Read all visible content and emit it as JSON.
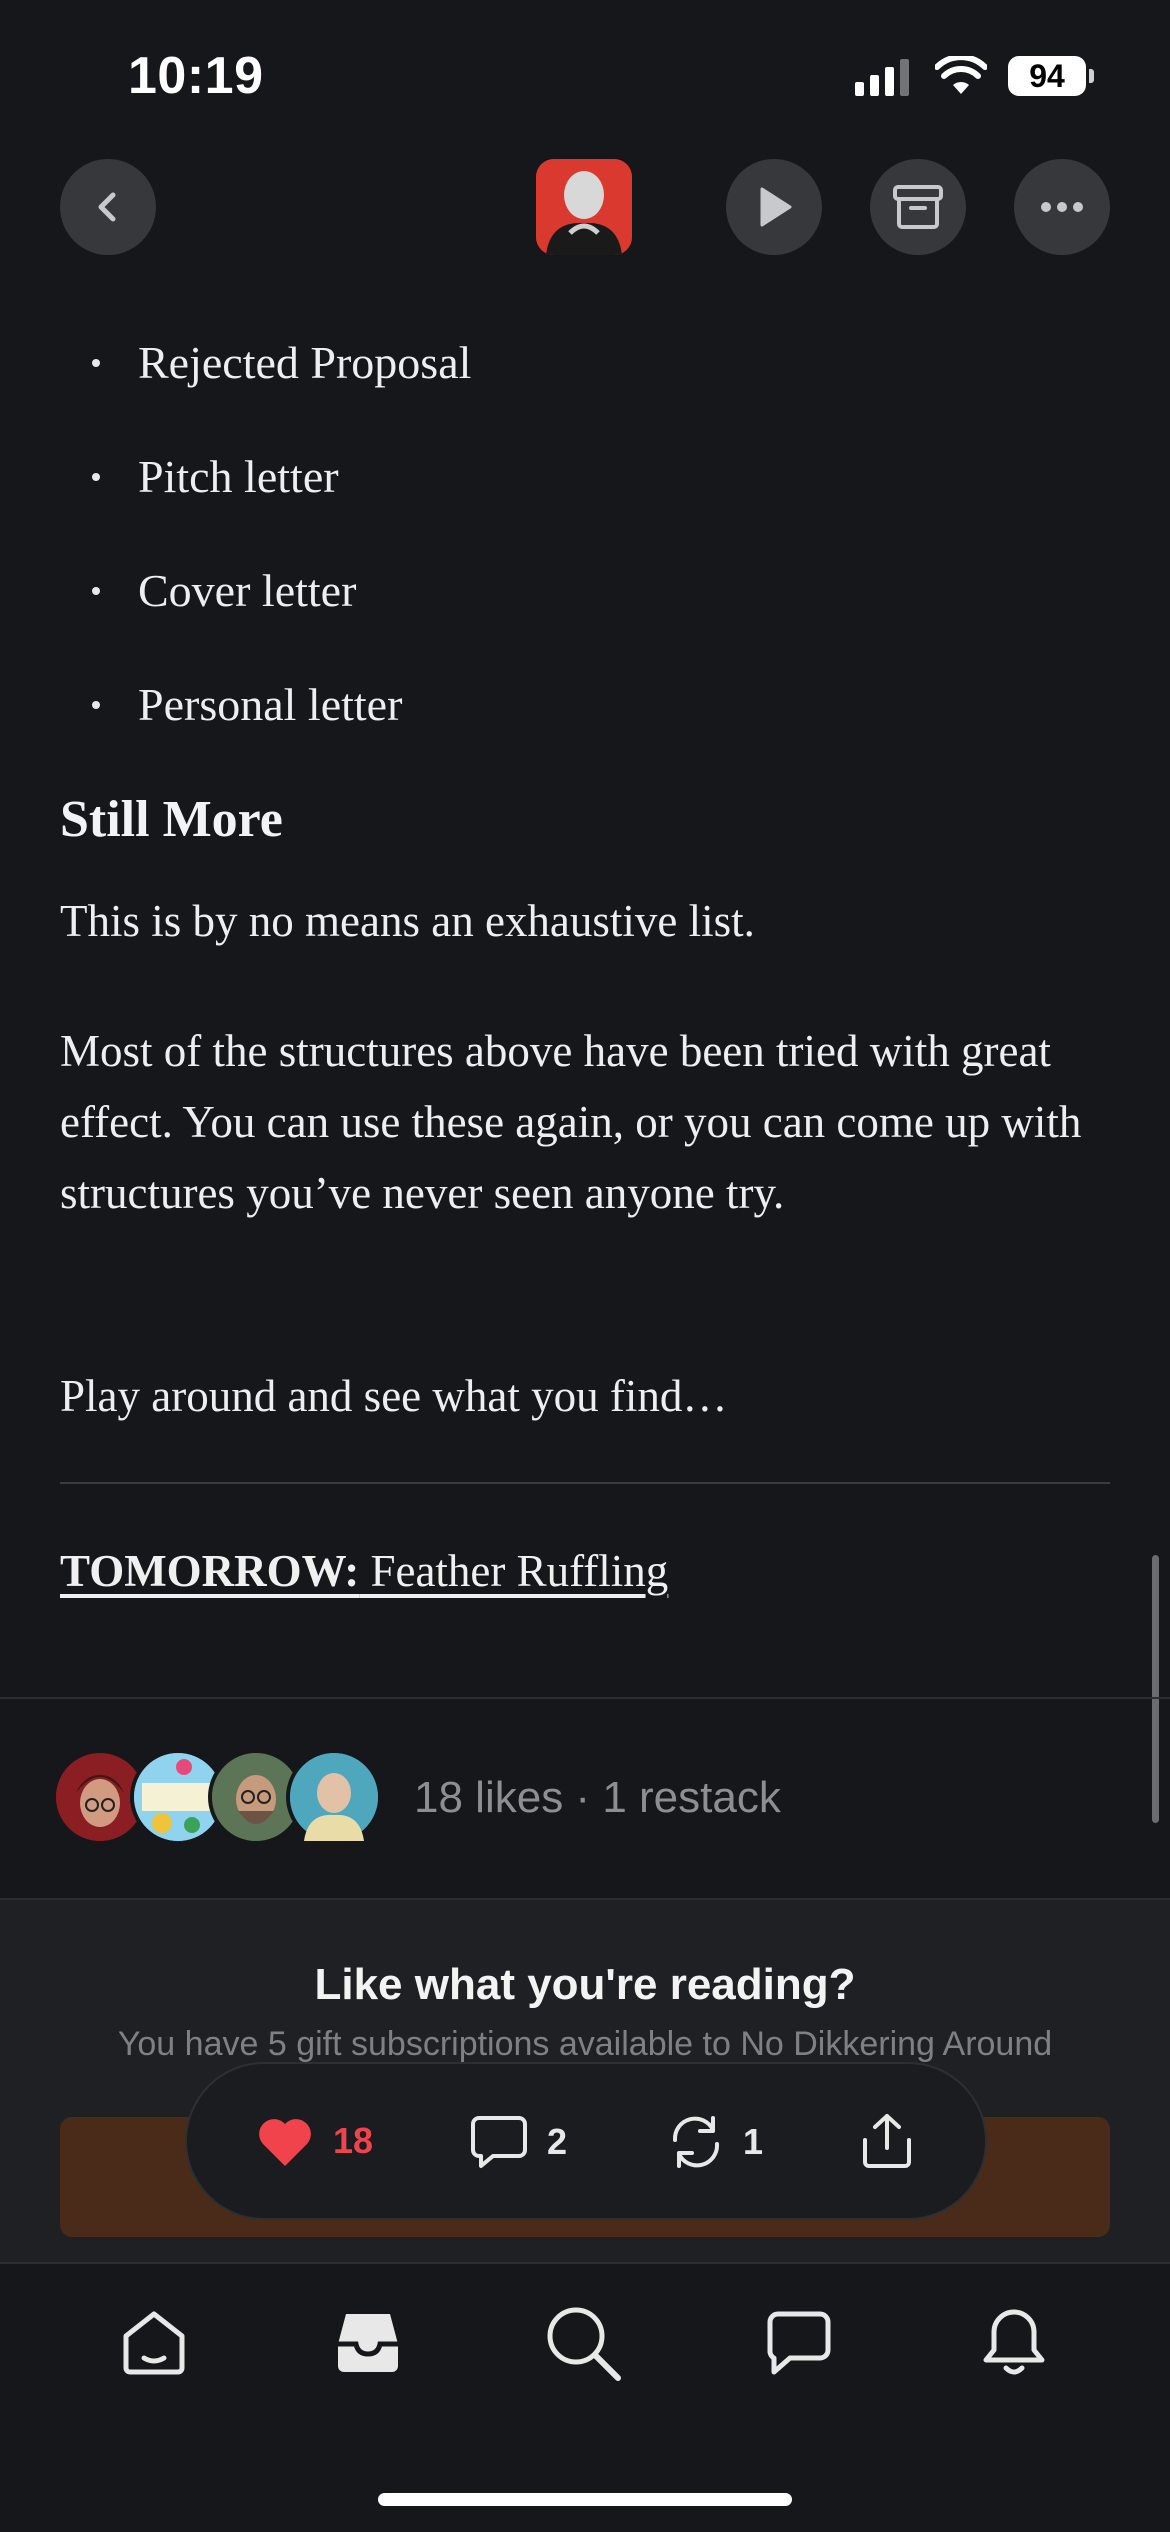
{
  "status_bar": {
    "time": "10:19",
    "battery": "94",
    "icons": [
      "cellular-signal-icon",
      "wifi-icon",
      "battery-icon"
    ]
  },
  "top_nav": {
    "back_icon": "chevron-left-icon",
    "author_avatar": "author-avatar",
    "play_icon": "play-icon",
    "archive_icon": "archive-icon",
    "more_icon": "ellipsis-icon"
  },
  "article": {
    "bullets": [
      "Rejected Proposal",
      "Pitch letter",
      "Cover letter",
      "Personal letter"
    ],
    "heading": "Still More",
    "paragraphs": [
      "This is by no means an exhaustive list.",
      "Most of the structures above have been tried with great effect. You can use these again, or you can come up with structures you’ve never seen anyone try.",
      "Play around and see what you find…"
    ],
    "tomorrow_label": "TOMORROW:",
    "tomorrow_link": " Feather Ruffling"
  },
  "engagement": {
    "likes_text": "18 likes",
    "separator": "·",
    "restack_text": "1 restack"
  },
  "subscribe_panel": {
    "title": "Like what you're reading?",
    "subtitle": "You have 5 gift subscriptions available to No Dikkering Around"
  },
  "action_bar": {
    "likes": "18",
    "comments": "2",
    "restacks": "1"
  },
  "colors": {
    "background": "#16171b",
    "like_red": "#f0434b",
    "panel_button": "#4a2b1a"
  },
  "tab_bar": {
    "items": [
      "home-icon",
      "inbox-icon",
      "search-icon",
      "chat-icon",
      "notifications-icon"
    ]
  }
}
